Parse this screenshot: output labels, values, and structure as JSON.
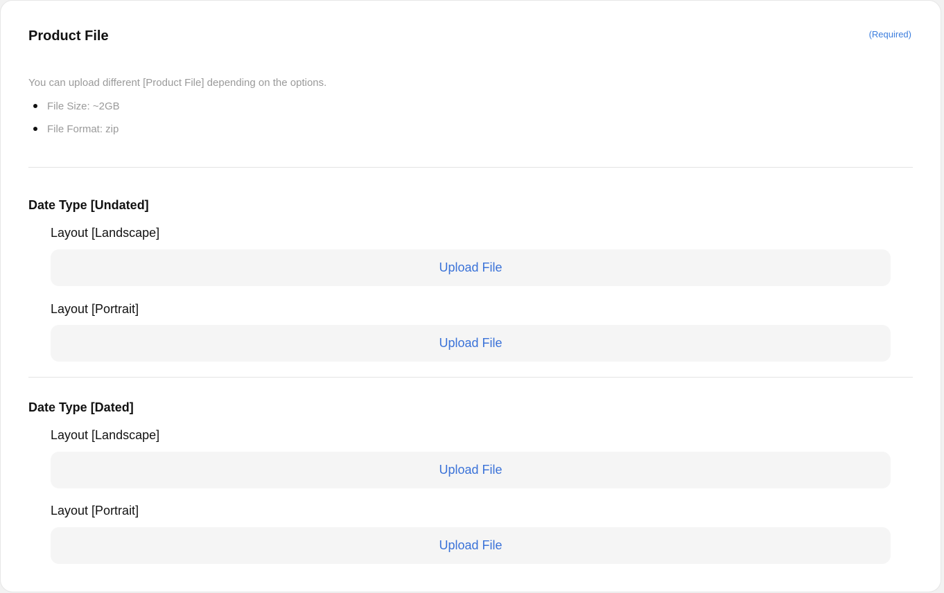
{
  "header": {
    "title": "Product File",
    "required_label": "(Required)"
  },
  "info": {
    "description": "You can upload different [Product File] depending on the options.",
    "bullets": [
      "File Size: ~2GB",
      "File Format: zip"
    ]
  },
  "sections": [
    {
      "title": "Date Type [Undated]",
      "layouts": [
        {
          "label": "Layout [Landscape]",
          "button": "Upload File"
        },
        {
          "label": "Layout [Portrait]",
          "button": "Upload File"
        }
      ]
    },
    {
      "title": "Date Type [Dated]",
      "layouts": [
        {
          "label": "Layout [Landscape]",
          "button": "Upload File"
        },
        {
          "label": "Layout [Portrait]",
          "button": "Upload File"
        }
      ]
    }
  ],
  "colors": {
    "accent": "#3a72d8",
    "muted_text": "#9a9a9a",
    "upload_bg": "#f5f5f5"
  }
}
